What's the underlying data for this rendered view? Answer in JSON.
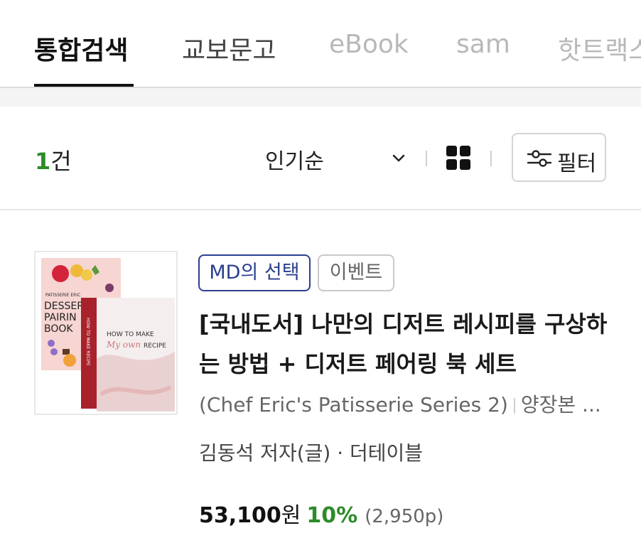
{
  "tabs": [
    {
      "label": "통합검색"
    },
    {
      "label": "교보문고"
    },
    {
      "label": "eBook"
    },
    {
      "label": "sam"
    },
    {
      "label": "핫트랙스"
    }
  ],
  "toolbar": {
    "count_num": "1",
    "count_unit": "건",
    "sort_label": "인기순",
    "filter_label": "필터"
  },
  "product": {
    "badges": [
      "MD의 선택",
      "이벤트"
    ],
    "title": "[국내도서] 나만의 디저트 레시피를 구상하는 방법 + 디저트 페어링 북 세트",
    "series": "(Chef Eric's Patisserie Series 2)",
    "binding": "양장본 ...",
    "author_line": "김동석 저자(글) · 더테이블",
    "price": "53,100",
    "price_unit": "원",
    "discount": "10%",
    "points": "(2,950p)",
    "cover": {
      "book1_series": "PATISSERIE ERIC",
      "book1_title": "DESSERT PAIRING BOOK",
      "book2_title_a": "HOW TO MAKE",
      "book2_title_b": "My own",
      "book2_title_c": "RECIPE"
    }
  },
  "colors": {
    "accent_green": "#2e8b2a",
    "md_blue": "#2b3f8f"
  }
}
